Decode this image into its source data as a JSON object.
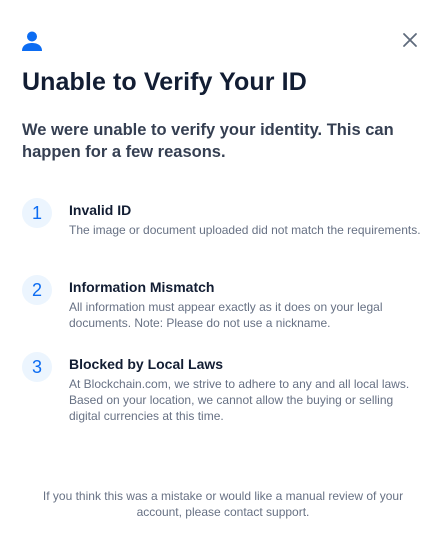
{
  "modal": {
    "title": "Unable to Verify Your ID",
    "intro": "We were unable to verify your identity. This can happen for a few reasons.",
    "icons": {
      "header": "user-icon",
      "close": "close-icon"
    },
    "reasons": [
      {
        "number": "1",
        "title": "Invalid ID",
        "description": "The image or document uploaded did not match the requirements."
      },
      {
        "number": "2",
        "title": "Information Mismatch",
        "description": "All information must appear exactly as it does on your legal documents. Note: Please do not use a nickname."
      },
      {
        "number": "3",
        "title": "Blocked by Local Laws",
        "description": "At Blockchain.com, we strive to adhere to any and all local laws. Based on your location, we cannot allow the buying or selling digital currencies at this time."
      }
    ],
    "footer": "If you think this was a mistake or would like a manual review of your account, please contact support."
  },
  "colors": {
    "primary": "#0c6cf2",
    "title": "#121d33",
    "body": "#353f52",
    "muted": "#677184",
    "badge_bg": "#ecf5fe"
  }
}
